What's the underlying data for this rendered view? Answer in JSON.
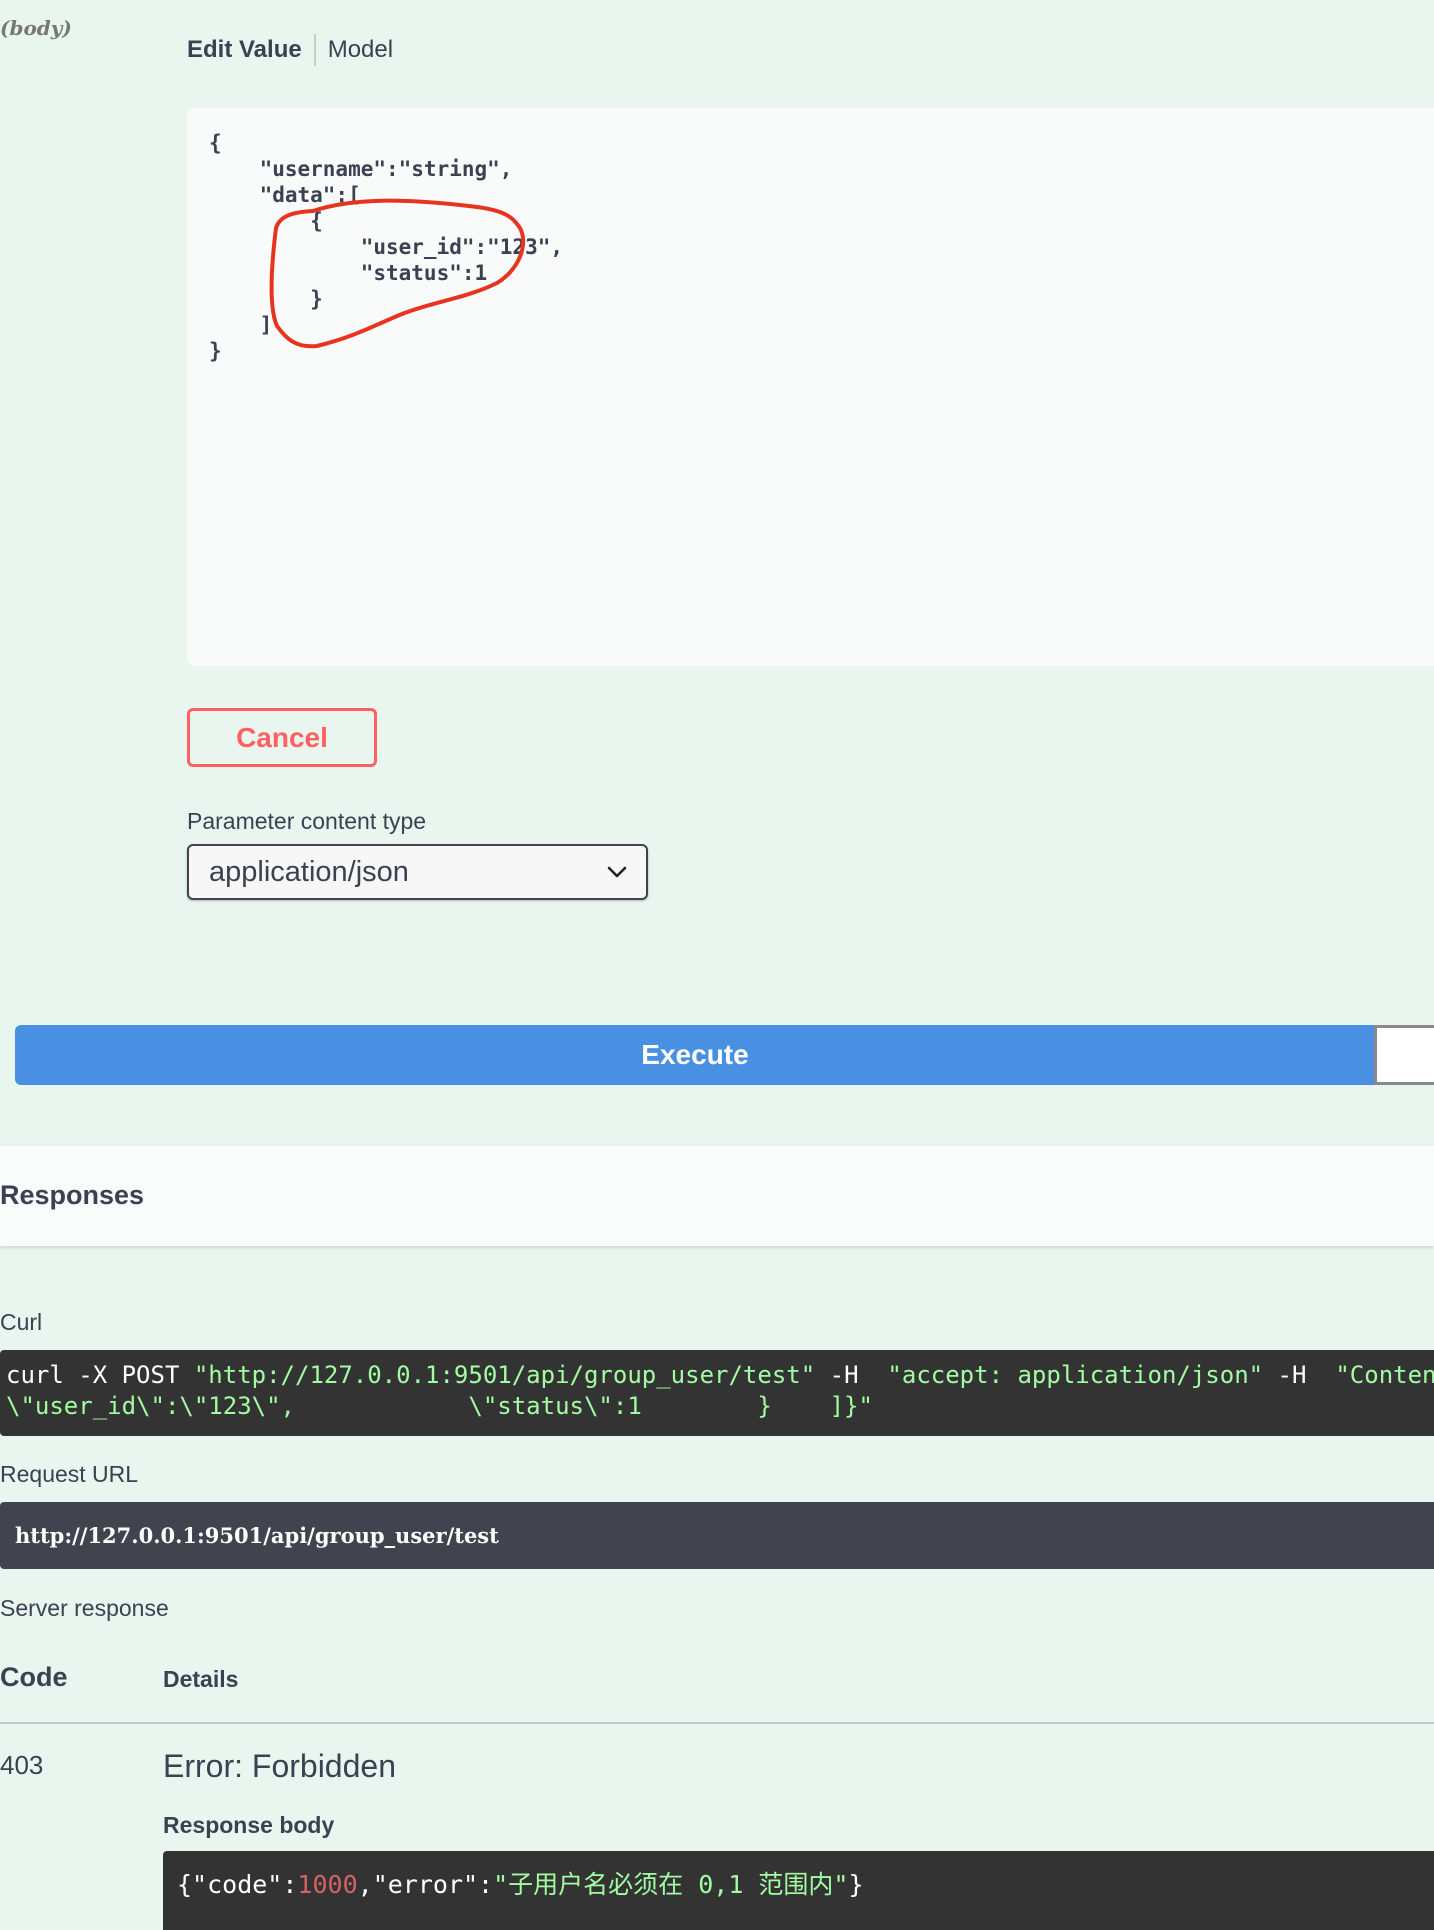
{
  "request_body": {
    "param_hint": "(body)",
    "tabs": {
      "edit_value": "Edit Value",
      "model": "Model"
    },
    "editor_text": "{\n    \"username\":\"string\",\n    \"data\":[\n        {\n            \"user_id\":\"123\",\n            \"status\":1\n        }\n    ]\n}",
    "annotation_color": "#e8331f"
  },
  "cancel_label": "Cancel",
  "content_type": {
    "label": "Parameter content type",
    "selected": "application/json"
  },
  "execute_label": "Execute",
  "responses": {
    "title": "Responses",
    "curl_label": "Curl",
    "curl": {
      "line1_cmd": "curl -X POST ",
      "line1_url": "\"http://127.0.0.1:9501/api/group_user/test\"",
      "line1_h1": " -H  ",
      "line1_accept": "\"accept: application/json\"",
      "line1_h2": " -H  ",
      "line1_content": "\"Content-Type: application/json\"",
      "line2": "\\\"user_id\\\":\\\"123\\\",            \\\"status\\\":1        }    ]}\""
    },
    "request_url_label": "Request URL",
    "request_url": "http://127.0.0.1:9501/api/group_user/test",
    "server_response_label": "Server response",
    "columns": {
      "code": "Code",
      "details": "Details"
    },
    "status_code": "403",
    "error_title": "Error: Forbidden",
    "response_body_label": "Response body",
    "body": {
      "p1": "{\"code\":",
      "code_value": "1000",
      "p2": ",\"error\":",
      "error_value": "\"子用户名必须在 0,1 范围内\"",
      "p3": "}"
    }
  }
}
